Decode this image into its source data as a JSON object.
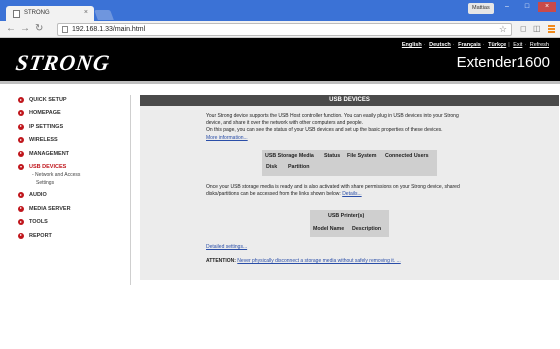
{
  "browser": {
    "tab_title": "STRONG",
    "tab_close": "×",
    "user": "Mattias",
    "url": "192.168.1.33/main.html",
    "window_buttons": [
      "–",
      "□",
      "×"
    ]
  },
  "header": {
    "logo": "STRONG",
    "model": "Extender1600",
    "languages": [
      "English",
      "Deutsch",
      "Français",
      "Türkçe"
    ],
    "exit_label": "Exit",
    "refresh_label": "Refresh"
  },
  "sidebar": {
    "items": [
      {
        "label": "QUICK SETUP"
      },
      {
        "label": "HOMEPAGE"
      },
      {
        "label": "IP SETTINGS"
      },
      {
        "label": "WIRELESS"
      },
      {
        "label": "MANAGEMENT"
      },
      {
        "label": "USB DEVICES"
      },
      {
        "label": "AUDIO"
      },
      {
        "label": "MEDIA SERVER"
      },
      {
        "label": "TOOLS"
      },
      {
        "label": "REPORT"
      }
    ],
    "sub_items": [
      "- Network and Access",
      "Settings"
    ]
  },
  "main": {
    "title": "USB DEVICES",
    "intro_lines": [
      "Your Strong device supports the USB Host controller function. You can easily plug in USB devices into your Strong",
      "device, and share it over the network with other computers and people.",
      "On this page, you can see the status of your USB devices and set up the basic properties of these devices."
    ],
    "more_info_link": "More information...",
    "storage_table": {
      "headers": [
        "USB Storage Media",
        "Status",
        "File System",
        "Connected Users"
      ],
      "subheaders": [
        "Disk",
        "Partition"
      ]
    },
    "share_lines": [
      "Once your USB storage media is ready and is also activated with share permissions on your Strong device, shared",
      "disks/partitions can be accessed from the links shown below:"
    ],
    "details_link": "Details...",
    "printer_table": {
      "title": "USB Printer(s)",
      "headers": [
        "Model Name",
        "Description"
      ]
    },
    "detailed_settings_link": "Detailed settings...",
    "attention_label": "ATTENTION:",
    "attention_link": "Never physically disconnect a storage media without safely removing it. ..."
  }
}
